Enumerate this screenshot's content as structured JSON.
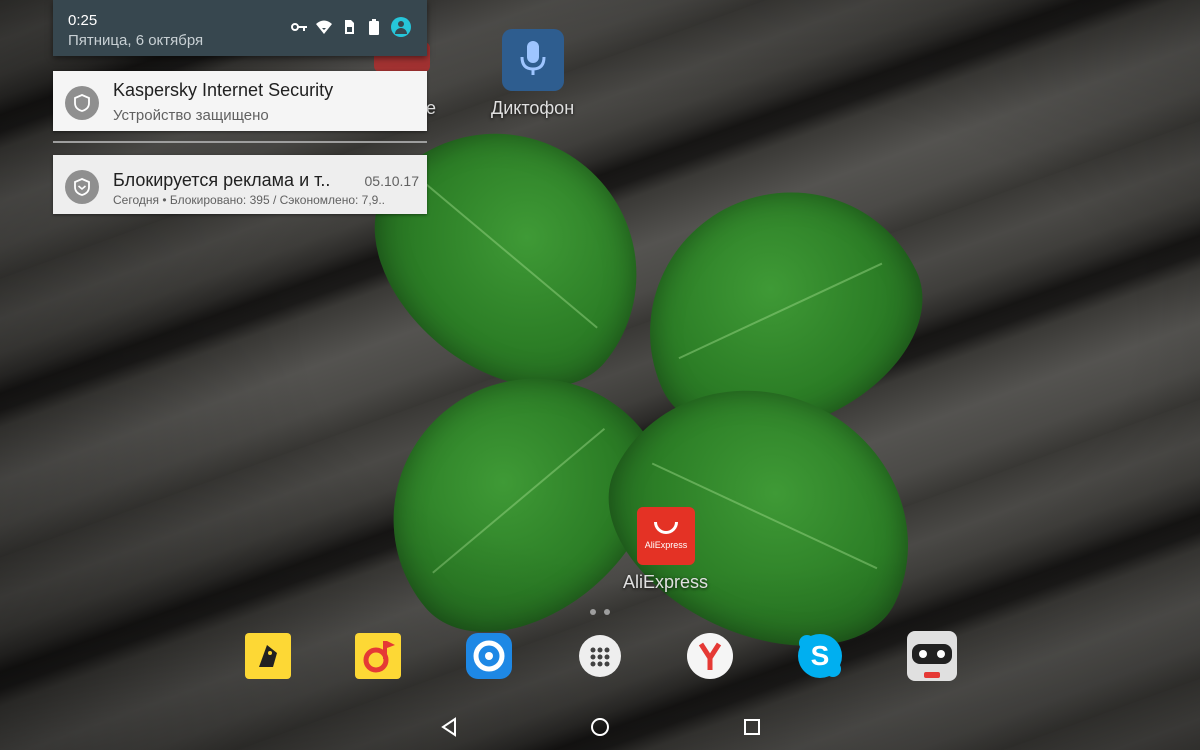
{
  "status_bar": {
    "time": "0:25",
    "date": "Пятница, 6 октября",
    "icons": [
      "vpn-key-icon",
      "wifi-icon",
      "sim-icon",
      "battery-icon",
      "account-icon"
    ]
  },
  "notifications": [
    {
      "icon": "shield-icon",
      "title": "Kaspersky Internet Security",
      "subtitle": "Устройство защищено"
    },
    {
      "icon": "shield-check-icon",
      "title": "Блокируется реклама и т..",
      "time": "05.10.17",
      "subtitle": "Сегодня • Блокировано: 395 / Сэкономлено: 7,9.."
    }
  ],
  "home_screen": {
    "apps": [
      {
        "name": "dictaphone",
        "label": "Диктофон",
        "icon": "microphone-icon"
      },
      {
        "name": "partial-app",
        "label": "е",
        "icon": "youtube-icon"
      },
      {
        "name": "aliexpress",
        "label": "AliExpress",
        "icon": "aliexpress-icon",
        "icon_text": "AliExpress"
      }
    ],
    "dock": [
      {
        "name": "yandex-market",
        "icon": "yandex-market-icon"
      },
      {
        "name": "yandex-music",
        "icon": "yandex-music-icon"
      },
      {
        "name": "app-circle",
        "icon": "blue-circle-app-icon"
      },
      {
        "name": "app-drawer",
        "icon": "app-drawer-icon"
      },
      {
        "name": "yandex-browser",
        "icon": "yandex-browser-icon"
      },
      {
        "name": "skype",
        "icon": "skype-icon"
      },
      {
        "name": "robot-app",
        "icon": "robot-icon"
      }
    ]
  },
  "navigation": [
    "back-icon",
    "home-icon",
    "recents-icon"
  ],
  "colors": {
    "shade": "#37474f",
    "notification_bg": "#f5f5f5",
    "aliexpress_red": "#e43225",
    "yandex_red": "#e53935",
    "skype_blue": "#00aff0"
  }
}
